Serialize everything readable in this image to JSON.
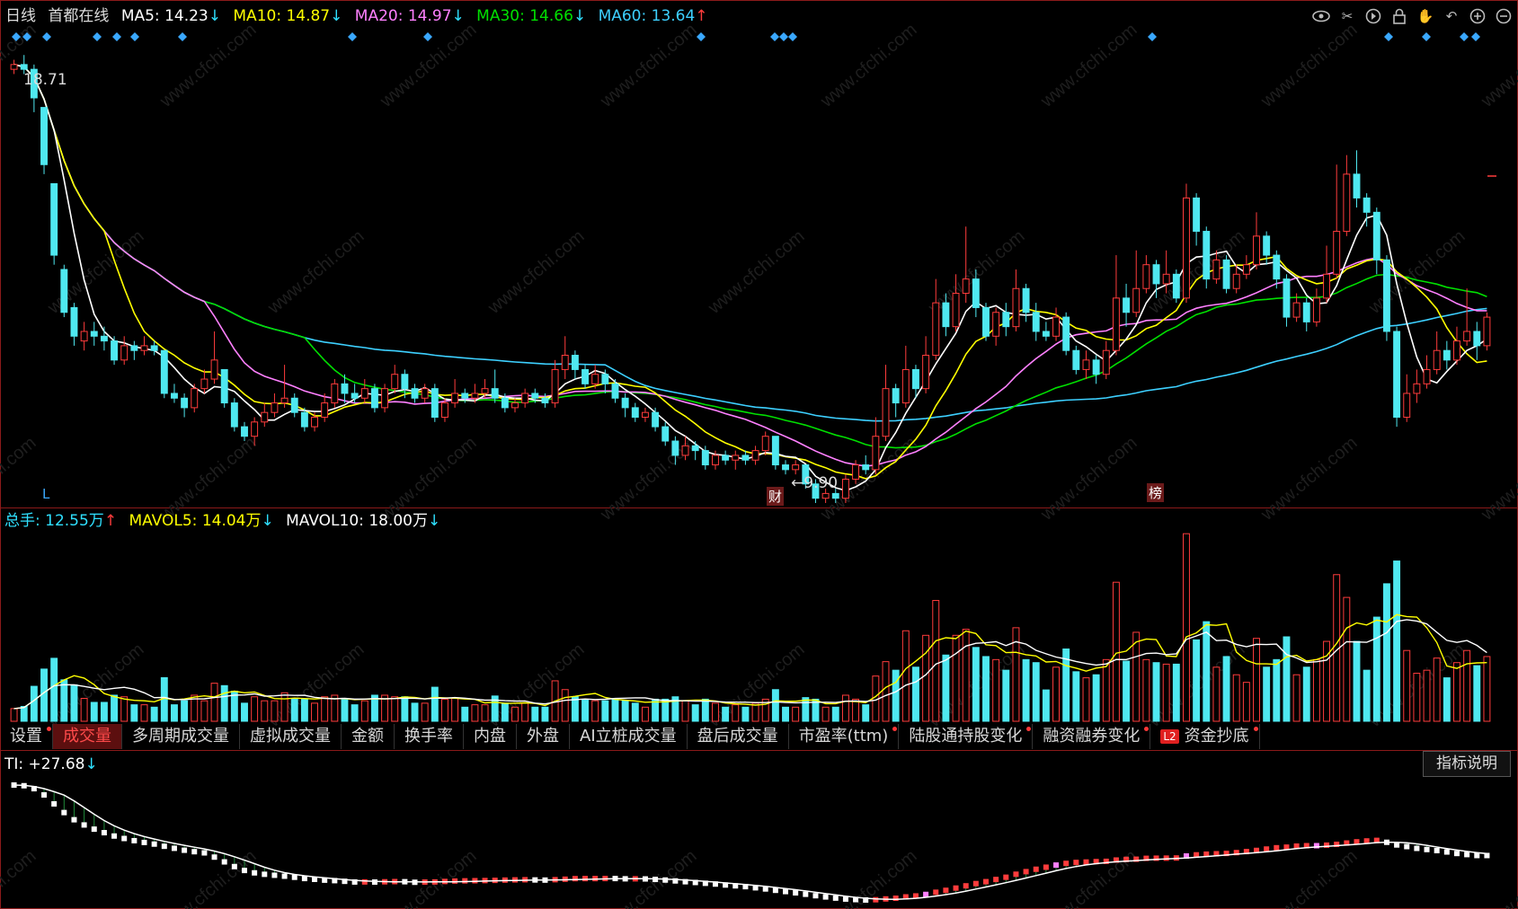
{
  "main_legend": {
    "period": "日线",
    "stock": "首都在线",
    "ma5": {
      "label": "MA5:",
      "value": "14.23",
      "arrow": "↓",
      "color": "#ffffff"
    },
    "ma10": {
      "label": "MA10:",
      "value": "14.87",
      "arrow": "↓",
      "color": "#ffff00"
    },
    "ma20": {
      "label": "MA20:",
      "value": "14.97",
      "arrow": "↓",
      "color": "#ff80ff"
    },
    "ma30": {
      "label": "MA30:",
      "value": "14.66",
      "arrow": "↓",
      "color": "#00e000"
    },
    "ma60": {
      "label": "MA60:",
      "value": "13.64",
      "arrow": "↑",
      "color": "#3dd0ff"
    }
  },
  "price_labels": {
    "high": "18.71",
    "low": "9.90",
    "low_prefix": "←"
  },
  "markers": {
    "cai": "财",
    "bang": "榜",
    "L": "L"
  },
  "volume_legend": {
    "total": {
      "label": "总手:",
      "value": "12.55万",
      "arrow": "↑"
    },
    "mavol5": {
      "label": "MAVOL5:",
      "value": "14.04万",
      "arrow": "↓"
    },
    "mavol10": {
      "label": "MAVOL10:",
      "value": "18.00万",
      "arrow": "↓"
    }
  },
  "tabs": [
    {
      "label": "设置",
      "dot": true
    },
    {
      "label": "成交量",
      "active": true
    },
    {
      "label": "多周期成交量"
    },
    {
      "label": "虚拟成交量"
    },
    {
      "label": "金额"
    },
    {
      "label": "换手率"
    },
    {
      "label": "内盘"
    },
    {
      "label": "外盘"
    },
    {
      "label": "AI立桩成交量"
    },
    {
      "label": "盘后成交量"
    },
    {
      "label": "市盈率(ttm)",
      "dot": true
    },
    {
      "label": "陆股通持股变化",
      "dot": true
    },
    {
      "label": "融资融券变化",
      "dot": true
    },
    {
      "label": "资金抄底",
      "dot": true,
      "l2": "L2"
    }
  ],
  "ti_legend": {
    "label": "TI:",
    "value": "+27.68",
    "arrow": "↓"
  },
  "help_button": "指标说明",
  "toolbar_icons": [
    "eye-icon",
    "scissors-icon",
    "refresh-icon",
    "lock-icon",
    "hand-icon",
    "undo-icon",
    "zoom-in-icon",
    "zoom-out-icon"
  ],
  "colors": {
    "up": "#ff3c3c",
    "down": "#4fe8f0",
    "border": "#8b1a1a",
    "diamond": "#3aa8ff"
  },
  "chart_data": [
    {
      "type": "candlestick",
      "title": "",
      "xlabel": "",
      "ylabel": "",
      "ylim": [
        9.5,
        19.3
      ],
      "candles": [
        {
          "o": 18.6,
          "c": 18.7,
          "h": 18.8,
          "l": 18.5
        },
        {
          "o": 18.7,
          "c": 18.6,
          "h": 18.9,
          "l": 18.5
        },
        {
          "o": 18.6,
          "c": 18.0,
          "h": 18.7,
          "l": 17.7
        },
        {
          "o": 17.8,
          "c": 16.6,
          "h": 17.8,
          "l": 16.4
        },
        {
          "o": 16.2,
          "c": 14.7,
          "h": 16.2,
          "l": 14.5
        },
        {
          "o": 14.4,
          "c": 13.5,
          "h": 14.5,
          "l": 13.4
        },
        {
          "o": 13.6,
          "c": 13.0,
          "h": 13.7,
          "l": 12.8
        },
        {
          "o": 12.9,
          "c": 13.1,
          "h": 13.3,
          "l": 12.7
        },
        {
          "o": 13.1,
          "c": 13.0,
          "h": 13.3,
          "l": 12.8
        },
        {
          "o": 13.0,
          "c": 12.9,
          "h": 13.2,
          "l": 12.7
        },
        {
          "o": 12.9,
          "c": 12.5,
          "h": 13.0,
          "l": 12.4
        },
        {
          "o": 12.5,
          "c": 12.8,
          "h": 13.0,
          "l": 12.4
        },
        {
          "o": 12.8,
          "c": 12.7,
          "h": 12.9,
          "l": 12.5
        },
        {
          "o": 12.7,
          "c": 12.8,
          "h": 13.0,
          "l": 12.6
        },
        {
          "o": 12.8,
          "c": 12.7,
          "h": 12.9,
          "l": 12.6
        },
        {
          "o": 12.7,
          "c": 11.8,
          "h": 12.7,
          "l": 11.7
        },
        {
          "o": 11.8,
          "c": 11.7,
          "h": 12.0,
          "l": 11.6
        },
        {
          "o": 11.7,
          "c": 11.5,
          "h": 11.8,
          "l": 11.3
        },
        {
          "o": 11.5,
          "c": 11.9,
          "h": 12.0,
          "l": 11.4
        },
        {
          "o": 11.9,
          "c": 12.1,
          "h": 12.3,
          "l": 11.8
        },
        {
          "o": 12.1,
          "c": 12.5,
          "h": 13.1,
          "l": 12.0
        },
        {
          "o": 12.3,
          "c": 11.6,
          "h": 12.3,
          "l": 11.5
        },
        {
          "o": 11.6,
          "c": 11.1,
          "h": 11.7,
          "l": 11.0
        },
        {
          "o": 11.1,
          "c": 10.9,
          "h": 11.2,
          "l": 10.8
        },
        {
          "o": 10.9,
          "c": 11.2,
          "h": 11.3,
          "l": 10.7
        },
        {
          "o": 11.2,
          "c": 11.4,
          "h": 11.6,
          "l": 11.1
        },
        {
          "o": 11.4,
          "c": 11.6,
          "h": 11.8,
          "l": 11.3
        },
        {
          "o": 11.6,
          "c": 11.7,
          "h": 12.4,
          "l": 11.5
        },
        {
          "o": 11.7,
          "c": 11.4,
          "h": 11.8,
          "l": 11.3
        },
        {
          "o": 11.4,
          "c": 11.1,
          "h": 11.5,
          "l": 11.0
        },
        {
          "o": 11.1,
          "c": 11.3,
          "h": 11.4,
          "l": 11.0
        },
        {
          "o": 11.3,
          "c": 11.6,
          "h": 11.8,
          "l": 11.2
        },
        {
          "o": 11.6,
          "c": 12.0,
          "h": 12.1,
          "l": 11.5
        },
        {
          "o": 12.0,
          "c": 11.8,
          "h": 12.2,
          "l": 11.6
        },
        {
          "o": 11.8,
          "c": 11.7,
          "h": 12.0,
          "l": 11.6
        },
        {
          "o": 11.7,
          "c": 11.9,
          "h": 12.1,
          "l": 11.6
        },
        {
          "o": 11.9,
          "c": 11.5,
          "h": 12.0,
          "l": 11.4
        },
        {
          "o": 11.5,
          "c": 11.9,
          "h": 12.0,
          "l": 11.4
        },
        {
          "o": 11.9,
          "c": 12.2,
          "h": 12.4,
          "l": 11.8
        },
        {
          "o": 12.2,
          "c": 11.9,
          "h": 12.3,
          "l": 11.7
        },
        {
          "o": 11.9,
          "c": 11.7,
          "h": 12.0,
          "l": 11.6
        },
        {
          "o": 11.7,
          "c": 11.9,
          "h": 12.0,
          "l": 11.6
        },
        {
          "o": 11.9,
          "c": 11.3,
          "h": 12.0,
          "l": 11.2
        },
        {
          "o": 11.3,
          "c": 11.6,
          "h": 11.7,
          "l": 11.2
        },
        {
          "o": 11.6,
          "c": 11.8,
          "h": 12.1,
          "l": 11.5
        },
        {
          "o": 11.8,
          "c": 11.7,
          "h": 11.9,
          "l": 11.6
        },
        {
          "o": 11.7,
          "c": 11.8,
          "h": 12.0,
          "l": 11.6
        },
        {
          "o": 11.8,
          "c": 11.9,
          "h": 12.1,
          "l": 11.7
        },
        {
          "o": 11.9,
          "c": 11.7,
          "h": 12.3,
          "l": 11.6
        },
        {
          "o": 11.7,
          "c": 11.5,
          "h": 11.8,
          "l": 11.4
        },
        {
          "o": 11.5,
          "c": 11.6,
          "h": 11.7,
          "l": 11.4
        },
        {
          "o": 11.6,
          "c": 11.8,
          "h": 11.9,
          "l": 11.5
        },
        {
          "o": 11.8,
          "c": 11.7,
          "h": 11.9,
          "l": 11.6
        },
        {
          "o": 11.7,
          "c": 11.6,
          "h": 11.8,
          "l": 11.5
        },
        {
          "o": 11.6,
          "c": 12.3,
          "h": 12.5,
          "l": 11.5
        },
        {
          "o": 12.3,
          "c": 12.6,
          "h": 13.0,
          "l": 12.1
        },
        {
          "o": 12.6,
          "c": 12.3,
          "h": 12.7,
          "l": 12.1
        },
        {
          "o": 12.3,
          "c": 12.0,
          "h": 12.4,
          "l": 11.9
        },
        {
          "o": 12.0,
          "c": 12.2,
          "h": 12.4,
          "l": 11.9
        },
        {
          "o": 12.2,
          "c": 12.0,
          "h": 12.3,
          "l": 11.8
        },
        {
          "o": 12.0,
          "c": 11.7,
          "h": 12.1,
          "l": 11.6
        },
        {
          "o": 11.7,
          "c": 11.5,
          "h": 11.8,
          "l": 11.3
        },
        {
          "o": 11.5,
          "c": 11.3,
          "h": 11.6,
          "l": 11.2
        },
        {
          "o": 11.3,
          "c": 11.4,
          "h": 11.5,
          "l": 11.2
        },
        {
          "o": 11.4,
          "c": 11.1,
          "h": 11.5,
          "l": 11.0
        },
        {
          "o": 11.1,
          "c": 10.8,
          "h": 11.2,
          "l": 10.7
        },
        {
          "o": 10.8,
          "c": 10.5,
          "h": 10.9,
          "l": 10.3
        },
        {
          "o": 10.5,
          "c": 10.7,
          "h": 10.9,
          "l": 10.4
        },
        {
          "o": 10.7,
          "c": 10.6,
          "h": 10.8,
          "l": 10.4
        },
        {
          "o": 10.6,
          "c": 10.3,
          "h": 10.7,
          "l": 10.2
        },
        {
          "o": 10.3,
          "c": 10.5,
          "h": 10.6,
          "l": 10.2
        },
        {
          "o": 10.5,
          "c": 10.4,
          "h": 10.6,
          "l": 10.3
        },
        {
          "o": 10.4,
          "c": 10.5,
          "h": 10.6,
          "l": 10.2
        },
        {
          "o": 10.5,
          "c": 10.4,
          "h": 10.6,
          "l": 10.3
        },
        {
          "o": 10.4,
          "c": 10.6,
          "h": 10.7,
          "l": 10.3
        },
        {
          "o": 10.6,
          "c": 10.9,
          "h": 11.0,
          "l": 10.5
        },
        {
          "o": 10.9,
          "c": 10.3,
          "h": 10.9,
          "l": 10.2
        },
        {
          "o": 10.3,
          "c": 10.2,
          "h": 10.4,
          "l": 10.1
        },
        {
          "o": 10.2,
          "c": 10.3,
          "h": 10.4,
          "l": 10.1
        },
        {
          "o": 10.3,
          "c": 9.9,
          "h": 10.3,
          "l": 9.8
        },
        {
          "o": 9.9,
          "c": 9.6,
          "h": 10.0,
          "l": 9.5
        },
        {
          "o": 9.6,
          "c": 9.7,
          "h": 9.8,
          "l": 9.5
        },
        {
          "o": 9.7,
          "c": 9.6,
          "h": 9.8,
          "l": 9.5
        },
        {
          "o": 9.6,
          "c": 10.0,
          "h": 10.1,
          "l": 9.5
        },
        {
          "o": 10.0,
          "c": 10.3,
          "h": 10.4,
          "l": 9.9
        },
        {
          "o": 10.3,
          "c": 10.2,
          "h": 10.5,
          "l": 10.1
        },
        {
          "o": 10.2,
          "c": 10.9,
          "h": 11.3,
          "l": 10.1
        },
        {
          "o": 10.9,
          "c": 11.9,
          "h": 12.4,
          "l": 10.8
        },
        {
          "o": 11.9,
          "c": 11.6,
          "h": 12.0,
          "l": 11.3
        },
        {
          "o": 11.6,
          "c": 12.3,
          "h": 12.8,
          "l": 11.5
        },
        {
          "o": 12.3,
          "c": 11.9,
          "h": 12.4,
          "l": 11.7
        },
        {
          "o": 11.9,
          "c": 12.6,
          "h": 13.0,
          "l": 11.8
        },
        {
          "o": 12.6,
          "c": 13.7,
          "h": 14.2,
          "l": 12.5
        },
        {
          "o": 13.7,
          "c": 13.2,
          "h": 13.9,
          "l": 13.0
        },
        {
          "o": 13.2,
          "c": 13.9,
          "h": 14.3,
          "l": 13.1
        },
        {
          "o": 13.9,
          "c": 14.2,
          "h": 15.3,
          "l": 13.7
        },
        {
          "o": 14.2,
          "c": 13.6,
          "h": 14.4,
          "l": 13.4
        },
        {
          "o": 13.6,
          "c": 13.0,
          "h": 13.7,
          "l": 12.9
        },
        {
          "o": 13.0,
          "c": 13.5,
          "h": 13.6,
          "l": 12.8
        },
        {
          "o": 13.5,
          "c": 13.2,
          "h": 13.7,
          "l": 13.0
        },
        {
          "o": 13.2,
          "c": 14.0,
          "h": 14.4,
          "l": 13.1
        },
        {
          "o": 14.0,
          "c": 13.5,
          "h": 14.1,
          "l": 13.3
        },
        {
          "o": 13.5,
          "c": 13.1,
          "h": 13.7,
          "l": 12.9
        },
        {
          "o": 13.1,
          "c": 13.0,
          "h": 13.3,
          "l": 12.9
        },
        {
          "o": 13.0,
          "c": 13.4,
          "h": 13.6,
          "l": 12.9
        },
        {
          "o": 13.4,
          "c": 12.7,
          "h": 13.5,
          "l": 12.6
        },
        {
          "o": 12.7,
          "c": 12.3,
          "h": 12.8,
          "l": 12.2
        },
        {
          "o": 12.3,
          "c": 12.5,
          "h": 12.7,
          "l": 12.1
        },
        {
          "o": 12.5,
          "c": 12.2,
          "h": 12.6,
          "l": 12.0
        },
        {
          "o": 12.2,
          "c": 12.7,
          "h": 12.9,
          "l": 12.1
        },
        {
          "o": 12.7,
          "c": 13.8,
          "h": 14.7,
          "l": 12.6
        },
        {
          "o": 13.8,
          "c": 13.5,
          "h": 14.1,
          "l": 13.2
        },
        {
          "o": 13.5,
          "c": 14.0,
          "h": 14.8,
          "l": 13.4
        },
        {
          "o": 14.0,
          "c": 14.5,
          "h": 14.7,
          "l": 13.9
        },
        {
          "o": 14.5,
          "c": 14.1,
          "h": 14.6,
          "l": 13.8
        },
        {
          "o": 14.1,
          "c": 14.3,
          "h": 14.8,
          "l": 13.9
        },
        {
          "o": 14.3,
          "c": 13.8,
          "h": 14.4,
          "l": 13.7
        },
        {
          "o": 13.8,
          "c": 15.9,
          "h": 16.2,
          "l": 13.7
        },
        {
          "o": 15.9,
          "c": 15.2,
          "h": 16.0,
          "l": 14.9
        },
        {
          "o": 15.2,
          "c": 14.2,
          "h": 15.3,
          "l": 14.0
        },
        {
          "o": 14.2,
          "c": 14.6,
          "h": 14.8,
          "l": 14.1
        },
        {
          "o": 14.6,
          "c": 14.0,
          "h": 14.7,
          "l": 13.9
        },
        {
          "o": 14.0,
          "c": 14.3,
          "h": 14.5,
          "l": 13.9
        },
        {
          "o": 14.3,
          "c": 14.5,
          "h": 14.7,
          "l": 14.2
        },
        {
          "o": 14.5,
          "c": 15.1,
          "h": 15.6,
          "l": 14.4
        },
        {
          "o": 15.1,
          "c": 14.7,
          "h": 15.2,
          "l": 14.5
        },
        {
          "o": 14.7,
          "c": 14.2,
          "h": 14.8,
          "l": 14.0
        },
        {
          "o": 14.2,
          "c": 13.4,
          "h": 14.3,
          "l": 13.2
        },
        {
          "o": 13.4,
          "c": 13.7,
          "h": 13.9,
          "l": 13.3
        },
        {
          "o": 13.7,
          "c": 13.3,
          "h": 13.8,
          "l": 13.1
        },
        {
          "o": 13.3,
          "c": 13.8,
          "h": 14.0,
          "l": 13.2
        },
        {
          "o": 13.8,
          "c": 14.3,
          "h": 14.9,
          "l": 13.7
        },
        {
          "o": 14.3,
          "c": 15.2,
          "h": 16.6,
          "l": 14.2
        },
        {
          "o": 15.2,
          "c": 16.4,
          "h": 16.8,
          "l": 15.1
        },
        {
          "o": 16.4,
          "c": 15.9,
          "h": 16.9,
          "l": 15.7
        },
        {
          "o": 15.9,
          "c": 15.6,
          "h": 16.0,
          "l": 15.3
        },
        {
          "o": 15.6,
          "c": 14.6,
          "h": 15.7,
          "l": 14.3
        },
        {
          "o": 14.6,
          "c": 13.1,
          "h": 14.7,
          "l": 12.9
        },
        {
          "o": 13.1,
          "c": 11.3,
          "h": 13.2,
          "l": 11.1
        },
        {
          "o": 11.3,
          "c": 11.8,
          "h": 12.2,
          "l": 11.2
        },
        {
          "o": 11.8,
          "c": 12.0,
          "h": 12.3,
          "l": 11.6
        },
        {
          "o": 12.0,
          "c": 12.3,
          "h": 12.6,
          "l": 11.9
        },
        {
          "o": 12.3,
          "c": 12.7,
          "h": 13.1,
          "l": 12.2
        },
        {
          "o": 12.7,
          "c": 12.5,
          "h": 12.9,
          "l": 12.3
        },
        {
          "o": 12.5,
          "c": 12.9,
          "h": 13.2,
          "l": 12.4
        },
        {
          "o": 12.9,
          "c": 13.1,
          "h": 14.0,
          "l": 12.8
        },
        {
          "o": 13.1,
          "c": 12.8,
          "h": 13.3,
          "l": 12.5
        },
        {
          "o": 12.8,
          "c": 13.4,
          "h": 13.5,
          "l": 12.7
        }
      ],
      "series": [
        {
          "name": "MA5"
        },
        {
          "name": "MA10"
        },
        {
          "name": "MA20"
        },
        {
          "name": "MA30"
        },
        {
          "name": "MA60"
        }
      ]
    },
    {
      "type": "bar",
      "title": "",
      "xlabel": "",
      "ylabel": "",
      "series": [
        {
          "name": "总手"
        },
        {
          "name": "MAVOL5"
        },
        {
          "name": "MAVOL10"
        }
      ]
    },
    {
      "type": "bar",
      "title": "",
      "xlabel": "",
      "ylabel": "",
      "series": [
        {
          "name": "TI"
        }
      ]
    }
  ]
}
